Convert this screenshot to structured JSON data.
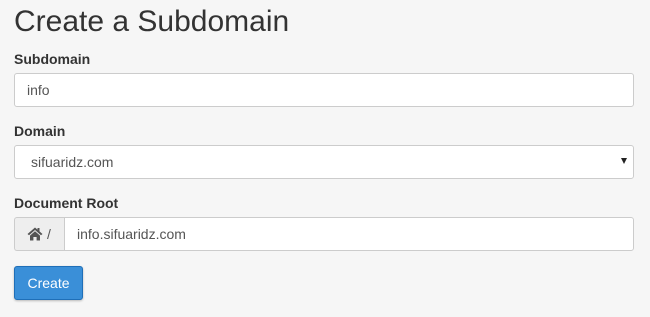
{
  "page": {
    "title": "Create a Subdomain"
  },
  "form": {
    "subdomain": {
      "label": "Subdomain",
      "value": "info"
    },
    "domain": {
      "label": "Domain",
      "selected": "sifuaridz.com"
    },
    "document_root": {
      "label": "Document Root",
      "prefix": "/",
      "prefix_icon": "home-icon",
      "value": "info.sifuaridz.com"
    },
    "submit_label": "Create"
  },
  "colors": {
    "background": "#f6f6f6",
    "primary_button": "#3a8fd8",
    "input_border": "#cccccc",
    "addon_background": "#eeeeee"
  }
}
